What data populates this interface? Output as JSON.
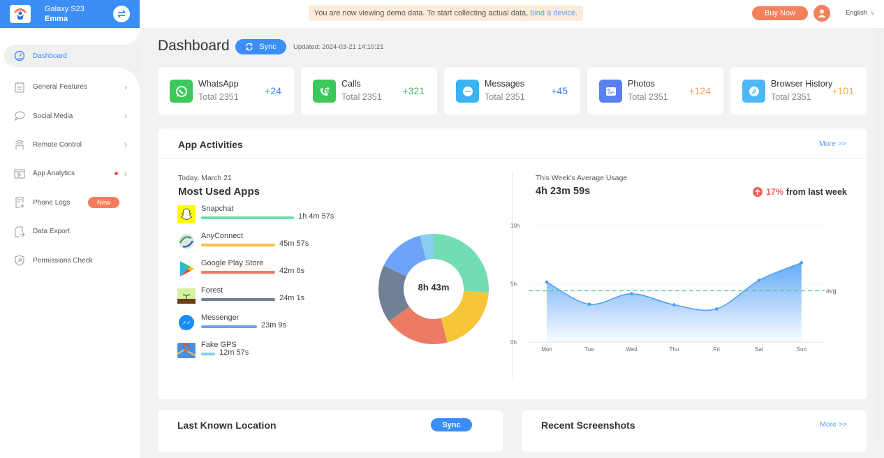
{
  "device": {
    "model": "Galaxy S23",
    "user": "Emma"
  },
  "sidebar": {
    "items": [
      {
        "label": "Dashboard",
        "icon": "gauge-icon",
        "active": true
      },
      {
        "label": "General Features",
        "icon": "clipboard-icon",
        "chevron": true
      },
      {
        "label": "Social Media",
        "icon": "chat-bubble-icon",
        "chevron": true
      },
      {
        "label": "Remote Control",
        "icon": "wifi-device-icon",
        "chevron": true
      },
      {
        "label": "App Analytics",
        "icon": "video-app-icon",
        "chevron": true,
        "dot": true
      },
      {
        "label": "Phone Logs",
        "icon": "log-file-icon",
        "badge": "New"
      },
      {
        "label": "Data Export",
        "icon": "export-icon"
      },
      {
        "label": "Permissions Check",
        "icon": "shield-key-icon"
      }
    ]
  },
  "topbar": {
    "demo_text": "You are now viewing demo data. To start collecting actual data,",
    "demo_link": "bind a device.",
    "buy_label": "Buy Now",
    "language": "English"
  },
  "header": {
    "title": "Dashboard",
    "sync_label": "Sync",
    "updated": "Updated: 2024-03-21 14:10:21"
  },
  "stats": [
    {
      "name": "WhatsApp",
      "total": "Total 2351",
      "delta": "+24",
      "icon": "whatsapp-icon",
      "color": "#3cc85a",
      "delta_color": "#3a8ef6"
    },
    {
      "name": "Calls",
      "total": "Total 2351",
      "delta": "+321",
      "icon": "phone-transfer-icon",
      "color": "#3cc85a",
      "delta_color": "#4caf6a"
    },
    {
      "name": "Messages",
      "total": "Total 2351",
      "delta": "+45",
      "icon": "message-icon",
      "color": "#3ab3f5",
      "delta_color": "#3a7fd5"
    },
    {
      "name": "Photos",
      "total": "Total 2351",
      "delta": "+124",
      "icon": "photo-icon",
      "color": "#5a7ff0",
      "delta_color": "#f0a050"
    },
    {
      "name": "Browser History",
      "total": "Total 2351",
      "delta": "+101",
      "icon": "compass-icon",
      "color": "#4cb8f5",
      "delta_color": "#f0b040"
    }
  ],
  "app_activities": {
    "title": "App Activities",
    "more": "More >>",
    "date": "Today, March 21",
    "subtitle": "Most Used Apps",
    "apps": [
      {
        "name": "Snapchat",
        "time": "1h 4m 57s",
        "color": "#6fdcb0",
        "fraction": 1.0,
        "icon": "snapchat-icon"
      },
      {
        "name": "AnyConnect",
        "time": "45m 57s",
        "color": "#f6c23e",
        "fraction": 0.8,
        "icon": "anyconnect-icon"
      },
      {
        "name": "Google Play Store",
        "time": "42m 6s",
        "color": "#ec7b64",
        "fraction": 0.8,
        "icon": "google-play-icon"
      },
      {
        "name": "Forest",
        "time": "24m 1s",
        "color": "#718096",
        "fraction": 0.8,
        "icon": "forest-icon"
      },
      {
        "name": "Messenger",
        "time": "23m 9s",
        "color": "#6aa0f5",
        "fraction": 0.6,
        "icon": "messenger-icon"
      },
      {
        "name": "Fake GPS",
        "time": "12m 57s",
        "color": "#87cfee",
        "fraction": 0.15,
        "icon": "fake-gps-icon"
      }
    ],
    "donut_total": "8h 43m",
    "week_label": "This Week's Average Usage",
    "week_value": "4h 23m 59s",
    "change_pct": "17%",
    "change_text": "from last week"
  },
  "chart_data": [
    {
      "type": "pie",
      "title": "Most Used Apps",
      "center_label": "8h 43m",
      "labels": [
        "Snapchat",
        "AnyConnect",
        "Google Play Store",
        "Forest",
        "Messenger",
        "Fake GPS"
      ],
      "values": [
        0.26,
        0.2,
        0.19,
        0.17,
        0.14,
        0.04
      ],
      "colors": [
        "#72dcb4",
        "#f7c43a",
        "#ec7b64",
        "#718096",
        "#6ea3f7",
        "#87cfee"
      ]
    },
    {
      "type": "area",
      "title": "This Week's Average Usage",
      "categories": [
        "Mon",
        "Tue",
        "Wed",
        "Thu",
        "Fri",
        "Sat",
        "Sun"
      ],
      "series": [
        {
          "name": "usage_hours",
          "values": [
            5.15,
            3.25,
            4.15,
            3.2,
            2.85,
            5.3,
            6.8
          ]
        }
      ],
      "avg": 4.4,
      "avg_label": "avg",
      "yticks": [
        "0h",
        "5h",
        "10h"
      ],
      "ylim": [
        0,
        10
      ],
      "line_color": "#4a9cf5",
      "avg_color": "#3ecf8e"
    }
  ],
  "location": {
    "title": "Last Known Location",
    "sync_label": "Sync"
  },
  "screenshots": {
    "title": "Recent Screenshots",
    "more": "More >>"
  }
}
